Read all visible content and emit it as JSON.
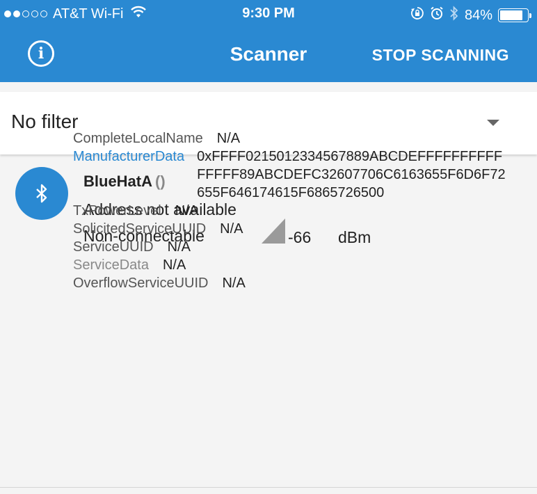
{
  "status_bar": {
    "carrier": "AT&T Wi-Fi",
    "time": "9:30 PM",
    "battery": "84%",
    "battery_level": 0.84,
    "signal_bars_filled": 2,
    "signal_bars_total": 5
  },
  "header": {
    "title": "Scanner",
    "stop_label": "STOP SCANNING",
    "info_glyph": "i",
    "color": "#2a89d2"
  },
  "filter": {
    "selected": "No filter"
  },
  "device": {
    "name": "BlueHatA",
    "name_suffix": "()",
    "address": "Address not available",
    "connectable": "Non-connectable",
    "rssi": "-66",
    "rssi_unit": "dBm",
    "icon": "bluetooth-icon"
  },
  "advertisement": {
    "complete_local_name": {
      "key": "CompleteLocalName",
      "value": "N/A"
    },
    "manufacturer_data": {
      "key": "ManufacturerData",
      "value": "0xFFFF0215012334567889ABCDEFFFFFFFFFFFFFFF89ABCDEFC32607706C6163655F6D6F72655F646174615F6865726500"
    },
    "tx_power_level": {
      "key": "TxPowerLevel",
      "value": "N/A"
    },
    "solicited_service_uuid": {
      "key": "SolicitedServiceUUID",
      "value": "N/A"
    },
    "service_uuid": {
      "key": "ServiceUUID",
      "value": "N/A"
    },
    "service_data": {
      "key": "ServiceData",
      "value": "N/A"
    },
    "overflow_service_uuid": {
      "key": "OverflowServiceUUID",
      "value": "N/A"
    }
  }
}
